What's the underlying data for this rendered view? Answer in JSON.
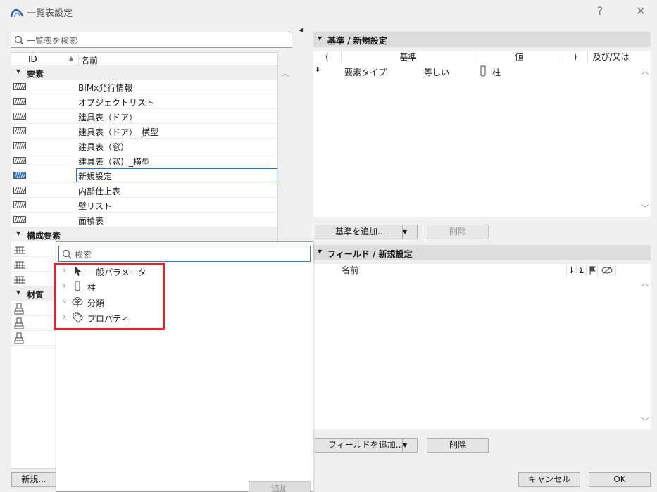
{
  "window": {
    "title": "一覧表設定",
    "help": "?",
    "close": "✕"
  },
  "left": {
    "search_placeholder": "一覧表を検索",
    "columns": {
      "id": "ID",
      "name": "名前"
    },
    "groups": [
      {
        "label": "要素",
        "items": [
          "BIMx発行情報",
          "オブジェクトリスト",
          "建具表（ドア）",
          "建具表（ドア）_横型",
          "建具表（窓）",
          "建具表（窓）_横型",
          "新規設定",
          "内部仕上表",
          "壁リスト",
          "面積表"
        ]
      },
      {
        "label": "構成要素",
        "items": [
          "",
          "",
          ""
        ]
      },
      {
        "label": "材質",
        "items": [
          "",
          "",
          ""
        ]
      }
    ],
    "selected_item": "新規設定",
    "new_button": "新規..."
  },
  "popup": {
    "search_placeholder": "検索",
    "items": [
      {
        "label": "一般パラメータ",
        "icon": "cursor-icon"
      },
      {
        "label": "柱",
        "icon": "column-icon"
      },
      {
        "label": "分類",
        "icon": "classification-icon"
      },
      {
        "label": "プロパティ",
        "icon": "tag-icon"
      }
    ],
    "add_button": "追加"
  },
  "criteria": {
    "title": "基準 /  新規設定",
    "columns": [
      "(",
      "基準",
      "値",
      ")",
      "及び/又は"
    ],
    "rows": [
      {
        "criterion": "要素タイプ",
        "op": "等しい",
        "value": "柱"
      }
    ],
    "add_button": "基準を追加...",
    "delete_button": "削除"
  },
  "fields": {
    "title": "フィールド /  新規設定",
    "columns": {
      "name": "名前"
    },
    "header_icons": [
      "↓",
      "Σ"
    ],
    "add_button": "フィールドを追加...",
    "delete_button": "削除"
  },
  "footer": {
    "cancel": "キャンセル",
    "ok": "OK"
  }
}
